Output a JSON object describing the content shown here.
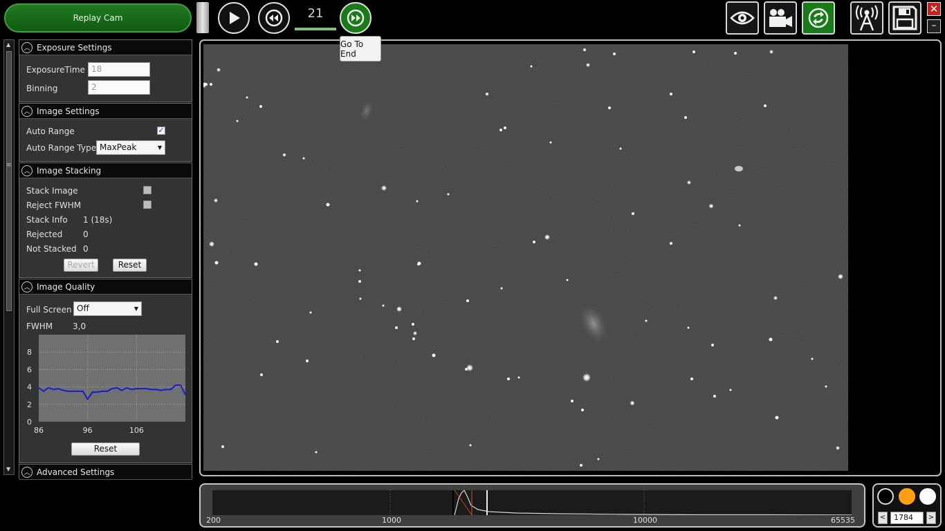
{
  "topbar": {
    "replay_label": "Replay Cam",
    "frame_count": "21",
    "tooltip": "Go To End",
    "icons": [
      "play-icon",
      "rewind-icon",
      "fast-forward-icon",
      "eye-icon",
      "video-camera-icon",
      "sync-icon",
      "antenna-icon",
      "floppy-disk-icon",
      "close-icon",
      "minimize-icon"
    ],
    "accent_green": "#1a7a1a"
  },
  "exposure": {
    "title": "Exposure Settings",
    "exposure_time_label": "ExposureTime",
    "exposure_time_value": "18",
    "binning_label": "Binning",
    "binning_value": "2"
  },
  "image_settings": {
    "title": "Image Settings",
    "auto_range_label": "Auto Range",
    "auto_range_checked": true,
    "auto_range_type_label": "Auto Range Type",
    "auto_range_type_value": "MaxPeak"
  },
  "stacking": {
    "title": "Image Stacking",
    "stack_image_label": "Stack Image",
    "reject_fwhm_label": "Reject FWHM",
    "stack_info_label": "Stack Info",
    "stack_info_value": "1 (18s)",
    "rejected_label": "Rejected",
    "rejected_value": "0",
    "not_stacked_label": "Not Stacked",
    "not_stacked_value": "0",
    "revert_label": "Revert",
    "reset_label": "Reset"
  },
  "quality": {
    "title": "Image Quality",
    "full_screen_label": "Full Screen",
    "full_screen_value": "Off",
    "fwhm_label": "FWHM",
    "fwhm_value": "3,0",
    "reset_label": "Reset",
    "chart_data": {
      "type": "line",
      "x": [
        86,
        87,
        88,
        89,
        90,
        91,
        92,
        93,
        94,
        95,
        96,
        97,
        98,
        99,
        100,
        101,
        102,
        103,
        104,
        105,
        106,
        107,
        108,
        109,
        110,
        111,
        112,
        113,
        114,
        115,
        116
      ],
      "series": [
        {
          "values": [
            3.9,
            3.5,
            3.9,
            3.7,
            3.8,
            3.6,
            3.5,
            3.5,
            3.5,
            3.5,
            2.6,
            3.4,
            3.4,
            3.5,
            3.5,
            3.8,
            3.9,
            3.6,
            3.9,
            3.7,
            3.8,
            3.8,
            3.8,
            3.7,
            3.7,
            3.6,
            3.7,
            3.7,
            4.2,
            4.2,
            3.1
          ]
        }
      ],
      "xticks": [
        "86",
        "96",
        "106"
      ],
      "yticks": [
        "0",
        "2",
        "4",
        "6",
        "8"
      ],
      "xlim": [
        86,
        116
      ],
      "ylim": [
        0,
        10
      ],
      "grid": true,
      "line_color": "#1a1ad0"
    }
  },
  "advanced": {
    "title": "Advanced Settings"
  },
  "histogram": {
    "labels": [
      "200",
      "1000",
      "10000",
      "65535"
    ]
  },
  "color_controls": {
    "stretch_value": "1784",
    "prev_label": "<",
    "next_label": ">",
    "orange": "#ff9e10"
  }
}
